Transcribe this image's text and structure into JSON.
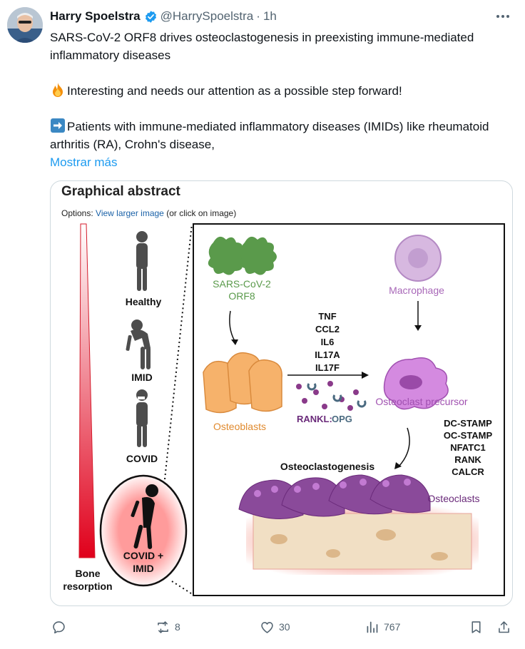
{
  "tweet": {
    "author_name": "Harry Spoelstra",
    "handle": "@HarrySpoelstra",
    "separator": "·",
    "time": "1h",
    "line1": "SARS-CoV-2 ORF8 drives osteoclastogenesis in preexisting immune-mediated inflammatory diseases",
    "line2": "Interesting and needs our attention as a possible step forward!",
    "line3": "Patients with immune-mediated inflammatory diseases (IMIDs) like rheumatoid arthritis (RA), Crohn's disease,",
    "show_more": "Mostrar más",
    "emoji_fire": "fire-emoji",
    "emoji_arrow": "right-arrow-emoji"
  },
  "figure": {
    "title": "Graphical abstract",
    "options_prefix": "Options: ",
    "options_link": "View larger image",
    "options_suffix": " (or click on image)",
    "stages": [
      "Healthy",
      "IMID",
      "COVID"
    ],
    "covid_imid_line1": "COVID +",
    "covid_imid_line2": "IMID",
    "bone_resorption_line1": "Bone",
    "bone_resorption_line2": "resorption",
    "orf8_line1": "SARS-CoV-2",
    "orf8_line2": "ORF8",
    "macrophage": "Macrophage",
    "cytokines": [
      "TNF",
      "CCL2",
      "IL6",
      "IL17A",
      "IL17F"
    ],
    "osteoblasts": "Osteoblasts",
    "rankl": "RANKL:",
    "opg": "OPG",
    "osteoclast_precursor": "Osteoclast precursor",
    "markers": [
      "DC-STAMP",
      "OC-STAMP",
      "NFATC1",
      "RANK",
      "CALCR"
    ],
    "osteoclastogenesis": "Osteoclastogenesis",
    "osteoclasts": "Osteoclasts"
  },
  "actions": {
    "reply_icon": "reply-icon",
    "retweet_count": "8",
    "like_count": "30",
    "views_count": "767",
    "bookmark_icon": "bookmark-icon",
    "share_icon": "share-icon"
  },
  "colors": {
    "accent": "#1d9bf0",
    "text_secondary": "#536471",
    "verified": "#1d9bf0",
    "orf8_green": "#5a9a4b",
    "macrophage_purple": "#a868b8",
    "osteoblast_orange": "#f2a65a",
    "osteoclast_purple": "#8a4a9a",
    "bone_red": "#e0001b"
  }
}
